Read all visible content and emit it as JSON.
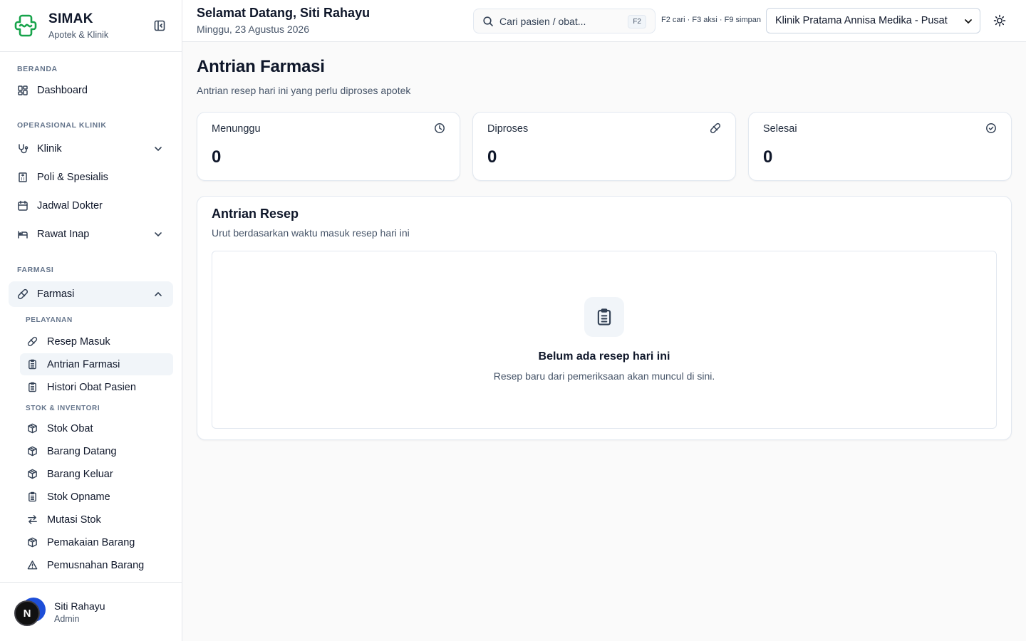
{
  "brand": {
    "name": "SIMAK",
    "subtitle": "Apotek & Klinik"
  },
  "header": {
    "greeting": "Selamat Datang, Siti Rahayu",
    "date": "Minggu, 23 Agustus 2026",
    "search_placeholder": "Cari pasien / obat...",
    "search_shortcut": "F2",
    "shortcut_hints": "F2 cari · F3 aksi · F9 simpan",
    "clinic_selected": "Klinik Pratama Annisa Medika - Pusat"
  },
  "sidebar": {
    "sections": {
      "beranda": "BERANDA",
      "operasional": "OPERASIONAL KLINIK",
      "farmasi": "FARMASI"
    },
    "items": {
      "dashboard": "Dashboard",
      "klinik": "Klinik",
      "poli": "Poli & Spesialis",
      "jadwal": "Jadwal Dokter",
      "rawat_inap": "Rawat Inap",
      "farmasi": "Farmasi"
    },
    "sub_sections": {
      "pelayanan": "PELAYANAN",
      "stok": "STOK & INVENTORI"
    },
    "sub_items": {
      "resep_masuk": "Resep Masuk",
      "antrian_farmasi": "Antrian Farmasi",
      "histori_obat": "Histori Obat Pasien",
      "stok_obat": "Stok Obat",
      "barang_datang": "Barang Datang",
      "barang_keluar": "Barang Keluar",
      "stok_opname": "Stok Opname",
      "mutasi_stok": "Mutasi Stok",
      "pemakaian_barang": "Pemakaian Barang",
      "pemusnahan_barang": "Pemusnahan Barang"
    }
  },
  "user": {
    "name": "Siti Rahayu",
    "role": "Admin",
    "avatar_initial": "N"
  },
  "main": {
    "title": "Antrian Farmasi",
    "subtitle": "Antrian resep hari ini yang perlu diproses apotek",
    "stats": [
      {
        "label": "Menunggu",
        "value": "0",
        "icon": "clock-icon"
      },
      {
        "label": "Diproses",
        "value": "0",
        "icon": "pill-icon"
      },
      {
        "label": "Selesai",
        "value": "0",
        "icon": "check-circle-icon"
      }
    ],
    "queue": {
      "title": "Antrian Resep",
      "subtitle": "Urut berdasarkan waktu masuk resep hari ini",
      "empty_title": "Belum ada resep hari ini",
      "empty_subtitle": "Resep baru dari pemeriksaan akan muncul di sini."
    }
  },
  "colors": {
    "brand": "#16a34a",
    "active_bg": "#f1f5f9",
    "border": "#e5e7eb",
    "avatar_accent": "#1d4ed8"
  }
}
